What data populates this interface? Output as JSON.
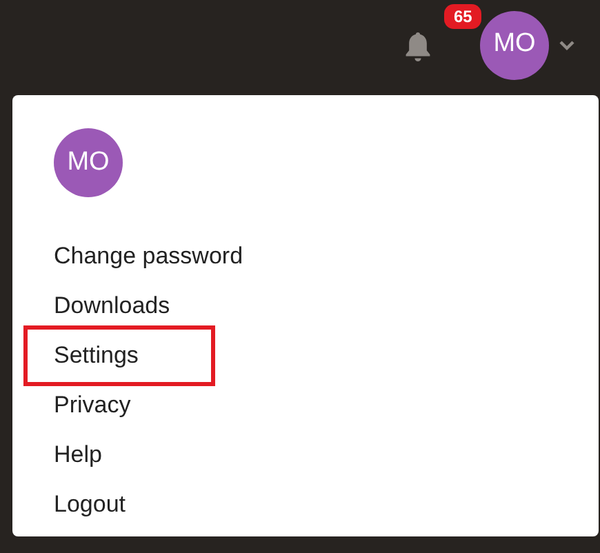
{
  "header": {
    "notification_count": "65",
    "avatar_initials": "MO"
  },
  "menu": {
    "avatar_initials": "MO",
    "items": [
      {
        "label": "Change password",
        "highlighted": false
      },
      {
        "label": "Downloads",
        "highlighted": false
      },
      {
        "label": "Settings",
        "highlighted": true
      },
      {
        "label": "Privacy",
        "highlighted": false
      },
      {
        "label": "Help",
        "highlighted": false
      },
      {
        "label": "Logout",
        "highlighted": false
      }
    ]
  }
}
